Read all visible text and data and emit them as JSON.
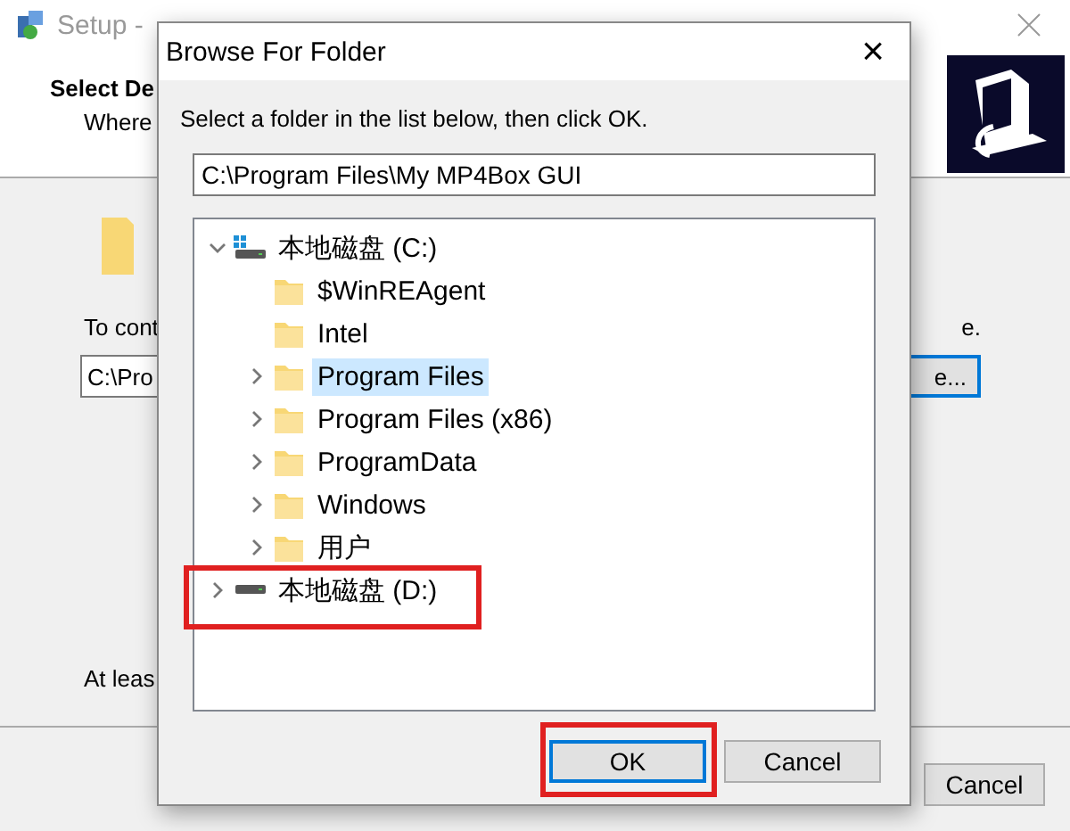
{
  "setup_window": {
    "title": "Setup -",
    "heading": "Select De",
    "subheading": "Where",
    "instruction": "To cont",
    "path_value": "C:\\Pro",
    "instruction_end": "e.",
    "browse_button": "e...",
    "footer_note": "At leas",
    "cancel_button": "Cancel"
  },
  "dialog": {
    "title": "Browse For Folder",
    "close": "×",
    "instruction": "Select a folder in the list below, then click OK.",
    "path_value": "C:\\Program Files\\My MP4Box GUI",
    "tree": [
      {
        "label": "本地磁盘 (C:)",
        "kind": "drive",
        "expanded": true,
        "selected": false,
        "children": [
          {
            "label": "$WinREAgent",
            "kind": "folder",
            "has_children": false,
            "selected": false
          },
          {
            "label": "Intel",
            "kind": "folder",
            "has_children": false,
            "selected": false
          },
          {
            "label": "Program Files",
            "kind": "folder",
            "has_children": true,
            "selected": true
          },
          {
            "label": "Program Files (x86)",
            "kind": "folder",
            "has_children": true,
            "selected": false
          },
          {
            "label": "ProgramData",
            "kind": "folder",
            "has_children": true,
            "selected": false
          },
          {
            "label": "Windows",
            "kind": "folder",
            "has_children": true,
            "selected": false
          },
          {
            "label": "用户",
            "kind": "folder",
            "has_children": true,
            "selected": false
          }
        ]
      },
      {
        "label": "本地磁盘 (D:)",
        "kind": "drive",
        "expanded": false,
        "selected": false,
        "highlighted": true
      }
    ],
    "buttons": [
      {
        "label": "OK",
        "default": true,
        "highlighted": true
      },
      {
        "label": "Cancel",
        "default": false,
        "highlighted": false
      }
    ]
  }
}
